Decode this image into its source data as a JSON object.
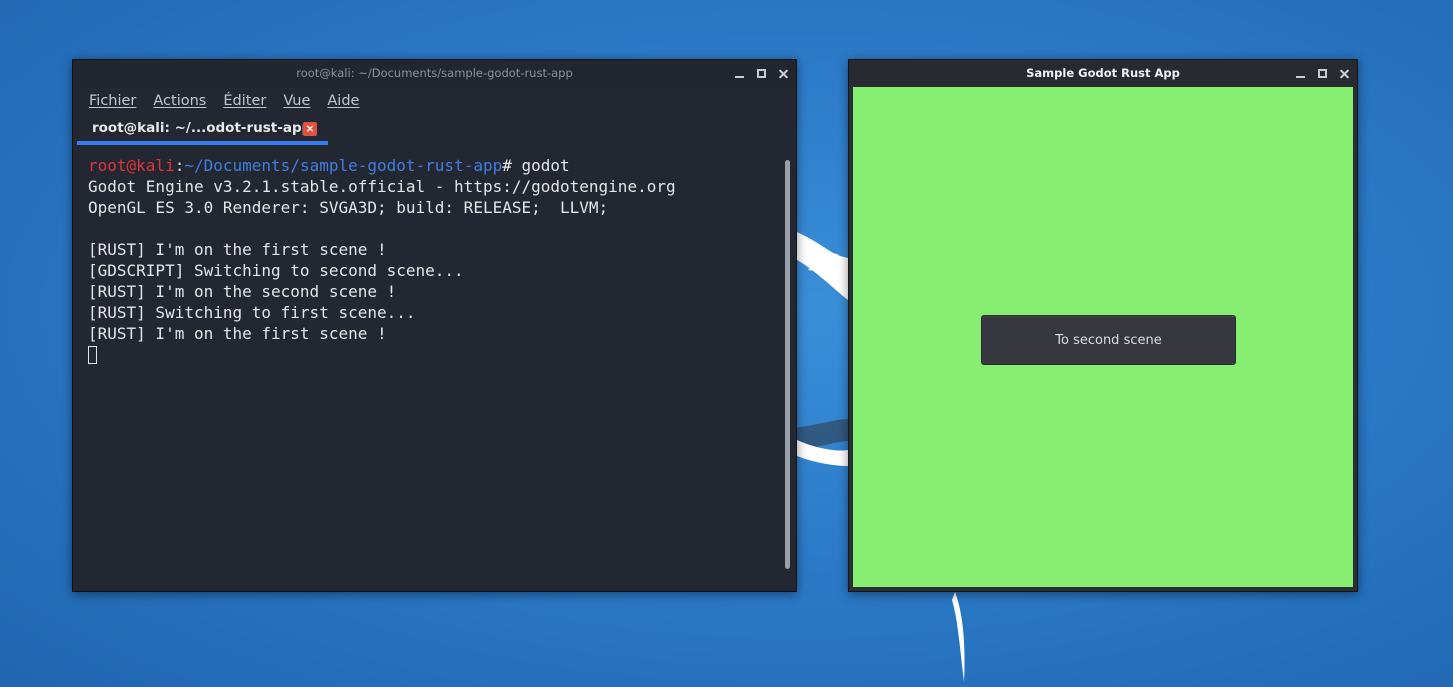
{
  "terminal": {
    "window_title": "root@kali: ~/Documents/sample-godot-rust-app",
    "menu": [
      "Fichier",
      "Actions",
      "Éditer",
      "Vue",
      "Aide"
    ],
    "tab_label": "root@kali: ~/...odot-rust-app",
    "tab_close_glyph": "×",
    "prompt": {
      "user_host": "root@kali",
      "colon": ":",
      "path": "~/Documents/sample-godot-rust-app",
      "command": "# godot"
    },
    "output_lines": [
      "Godot Engine v3.2.1.stable.official - https://godotengine.org",
      "OpenGL ES 3.0 Renderer: SVGA3D; build: RELEASE;  LLVM;",
      "",
      "[RUST] I'm on the first scene !",
      "[GDSCRIPT] Switching to second scene...",
      "[RUST] I'm on the second scene !",
      "[RUST] Switching to first scene...",
      "[RUST] I'm on the first scene !"
    ]
  },
  "godot_app": {
    "window_title": "Sample Godot Rust App",
    "button_label": "To second scene",
    "background_color": "#86ef72"
  },
  "colors": {
    "accent": "#367bf0",
    "prompt_user": "#e1333a",
    "prompt_path": "#3e7fe0",
    "tab_close": "#e0513f"
  }
}
